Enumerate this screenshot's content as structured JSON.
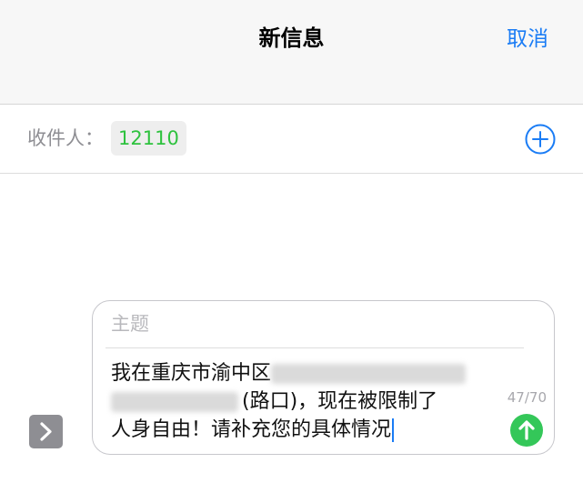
{
  "header": {
    "title": "新信息",
    "cancel_label": "取消"
  },
  "recipients": {
    "to_label": "收件人：",
    "recipient": "12110",
    "add_icon": "plus-circle-icon"
  },
  "compose": {
    "subject_placeholder": "主题",
    "message_line1": "我在重庆市渝中区",
    "message_line2": "(路口)，现在被限制了",
    "message_line3": "人身自由！请补充您的具体情况",
    "char_count": "47/70",
    "send_icon": "arrow-up-icon",
    "expand_icon": "chevron-right-icon"
  },
  "colors": {
    "accent": "#1a7cf5",
    "recipient_green": "#2ec23e",
    "send_green": "#34c759"
  }
}
